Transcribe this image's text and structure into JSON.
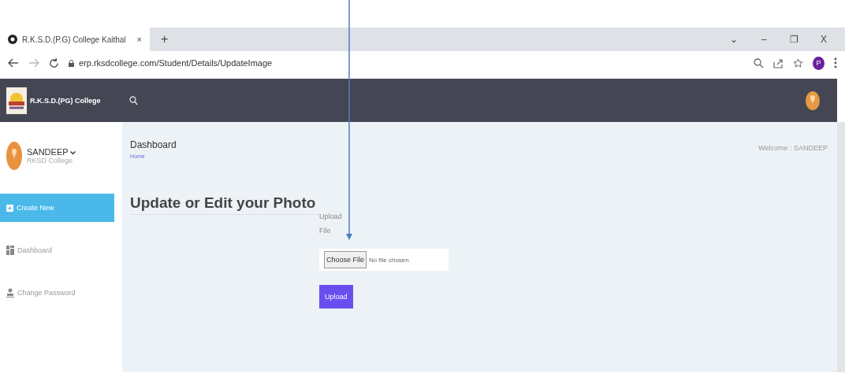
{
  "browser": {
    "tab_title": "R.K.S.D.(P.G) College Kaithal",
    "tab_close": "×",
    "new_tab": "+",
    "url": "erp.rksdcollege.com/Student/Details/UpdateImage",
    "profile_initial": "P",
    "window_controls": [
      "⌄",
      "–",
      "❐",
      "X"
    ]
  },
  "navbar": {
    "brand": "R.K.S.D.(PG) College"
  },
  "sidebar": {
    "user_name": "SANDEEP",
    "user_org": "RKSD College",
    "items": [
      {
        "label": "Create New",
        "kind": "add",
        "selected": true
      },
      {
        "label": "Dashboard",
        "kind": "grid",
        "selected": false
      },
      {
        "label": "Change Password",
        "kind": "user",
        "selected": false
      }
    ]
  },
  "header": {
    "title": "Dashboard",
    "breadcrumb": "Home",
    "welcome": "Welcome : SANDEEP"
  },
  "form": {
    "heading": "Update or Edit your Photo",
    "label": "Upload File",
    "choose_button": "Choose File",
    "file_status": "No file chosen",
    "upload_button": "Upload"
  }
}
